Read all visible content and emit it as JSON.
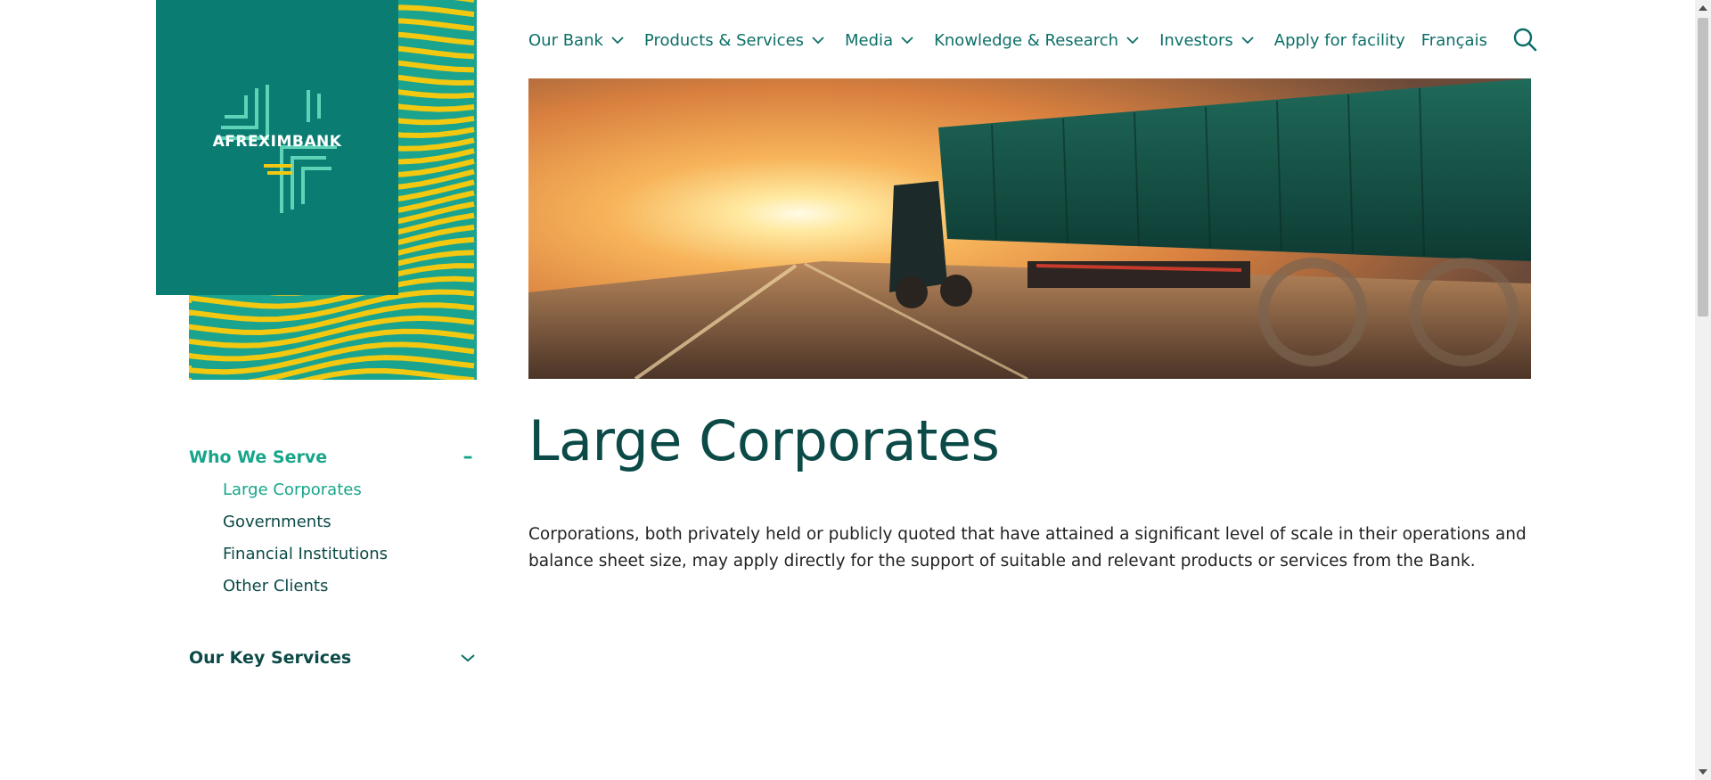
{
  "brand": {
    "logo_text": "AFREXIMBANK"
  },
  "nav": {
    "items": [
      {
        "label": "Our Bank",
        "dropdown": true
      },
      {
        "label": "Products & Services",
        "dropdown": true
      },
      {
        "label": "Media",
        "dropdown": true
      },
      {
        "label": "Knowledge & Research",
        "dropdown": true
      },
      {
        "label": "Investors",
        "dropdown": true
      },
      {
        "label": "Apply for facility",
        "dropdown": false
      },
      {
        "label": "Français",
        "dropdown": false
      }
    ],
    "search_icon": "search-icon"
  },
  "sidebar": {
    "sections": [
      {
        "title": "Who We Serve",
        "toggle": "–",
        "expanded": true,
        "items": [
          {
            "label": "Large Corporates",
            "active": true
          },
          {
            "label": "Governments",
            "active": false
          },
          {
            "label": "Financial Institutions",
            "active": false
          },
          {
            "label": "Other Clients",
            "active": false
          }
        ]
      },
      {
        "title": "Our Key Services",
        "expanded": false,
        "items": []
      }
    ]
  },
  "main": {
    "title": "Large Corporates",
    "description": "Corporations, both privately held or publicly quoted that have attained a significant level of scale in their operations and balance sheet size, may apply directly for the support of suitable and relevant products or services from the Bank."
  },
  "colors": {
    "brand_teal": "#0a7c72",
    "accent_green": "#18a58a",
    "dark_teal": "#0c4a47",
    "pattern_yellow": "#f2c811"
  }
}
